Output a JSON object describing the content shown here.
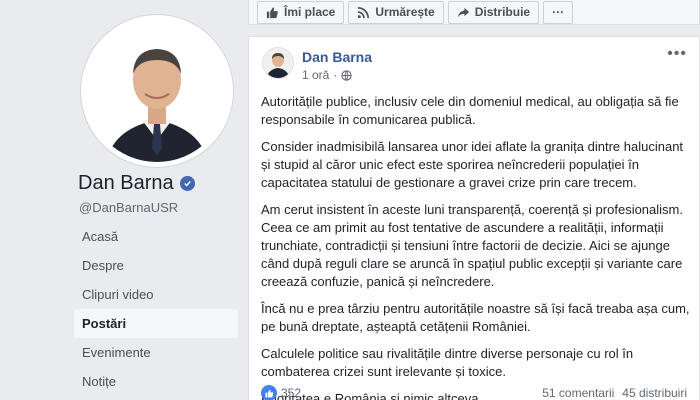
{
  "profile": {
    "name": "Dan Barna",
    "handle": "@DanBarnaUSR"
  },
  "nav": {
    "items": [
      {
        "label": "Acasă"
      },
      {
        "label": "Despre"
      },
      {
        "label": "Clipuri video"
      },
      {
        "label": "Postări"
      },
      {
        "label": "Evenimente"
      },
      {
        "label": "Notițe"
      }
    ],
    "active": "Postări"
  },
  "actions": {
    "like_label": "Îmi place",
    "follow_label": "Urmărește",
    "share_label": "Distribuie",
    "more_label": "···"
  },
  "post": {
    "author": "Dan Barna",
    "time": "1 oră",
    "more_label": "•••",
    "paragraphs": [
      "Autoritățile publice, inclusiv cele din domeniul medical, au obligația să fie responsabile în comunicarea publică.",
      "Consider inadmisibilă lansarea unor idei aflate la granița dintre halucinant și stupid al căror unic efect este sporirea neîncrederii populației în capacitatea statului de gestionare a gravei crize prin care trecem.",
      "Am cerut insistent în aceste luni transparență, coerență și profesionalism. Ceea ce am primit au fost tentative de ascundere a realității, informații trunchiate, contradicții și tensiuni între factorii de decizie. Aici se ajunge când după reguli clare se aruncă în spațiul public excepții și variante care creează confuzie, panică și neîncredere.",
      "Încă nu e prea târziu pentru autoritățile noastre să își facă treaba așa cum, pe bună dreptate, așteaptă cetățenii României.",
      "Calculele politice sau rivalitățile dintre diverse personaje cu rol în combaterea crizei sunt irelevante și toxice.",
      "Prioritatea e România și nimic altceva."
    ],
    "reactions": "352",
    "comments": "51 comentarii",
    "shares": "45 distribuiri"
  },
  "colors": {
    "brand_blue": "#4267b2",
    "link_blue": "#385898",
    "background": "#e9ebee"
  },
  "icons": {
    "verified": "verified-check-icon",
    "like": "thumbs-up-icon",
    "follow": "rss-icon",
    "share": "share-arrow-icon",
    "audience": "globe-icon"
  }
}
